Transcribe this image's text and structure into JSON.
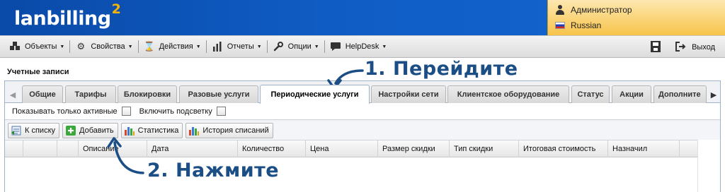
{
  "app": {
    "logo_text": "lanbilling",
    "logo_version": "2",
    "user": {
      "name": "Администратор",
      "language": "Russian"
    },
    "accent_color": "#f7b500"
  },
  "menu": {
    "items": [
      {
        "label": "Объекты",
        "icon": "cubes-icon"
      },
      {
        "label": "Свойства",
        "icon": "gear-icon"
      },
      {
        "label": "Действия",
        "icon": "hourglass-icon"
      },
      {
        "label": "Отчеты",
        "icon": "bar-chart-icon"
      },
      {
        "label": "Опции",
        "icon": "wrench-icon"
      },
      {
        "label": "HelpDesk",
        "icon": "chat-bubble-icon"
      }
    ],
    "exit_label": "Выход"
  },
  "panel": {
    "title": "Учетные записи",
    "tabs": [
      {
        "label": "Общие"
      },
      {
        "label": "Тарифы"
      },
      {
        "label": "Блокировки"
      },
      {
        "label": "Разовые услуги"
      },
      {
        "label": "Периодические услуги",
        "active": true
      },
      {
        "label": "Настройки сети"
      },
      {
        "label": "Клиентское оборудование"
      },
      {
        "label": "Статус"
      },
      {
        "label": "Акции"
      },
      {
        "label": "Дополните"
      }
    ],
    "options": {
      "show_active_only": "Показывать только активные",
      "highlight": "Включить подсветку"
    },
    "toolbar": {
      "back_label": "К списку",
      "add_label": "Добавить",
      "stats_label": "Статистика",
      "history_label": "История списаний"
    },
    "columns": [
      "Описание",
      "Дата",
      "Количество",
      "Цена",
      "Размер скидки",
      "Тип скидки",
      "Итоговая стоимость",
      "Назначил"
    ]
  },
  "annotations": {
    "step1": "1. Перейдите",
    "step2": "2. Нажмите",
    "color": "#1c4e86"
  }
}
